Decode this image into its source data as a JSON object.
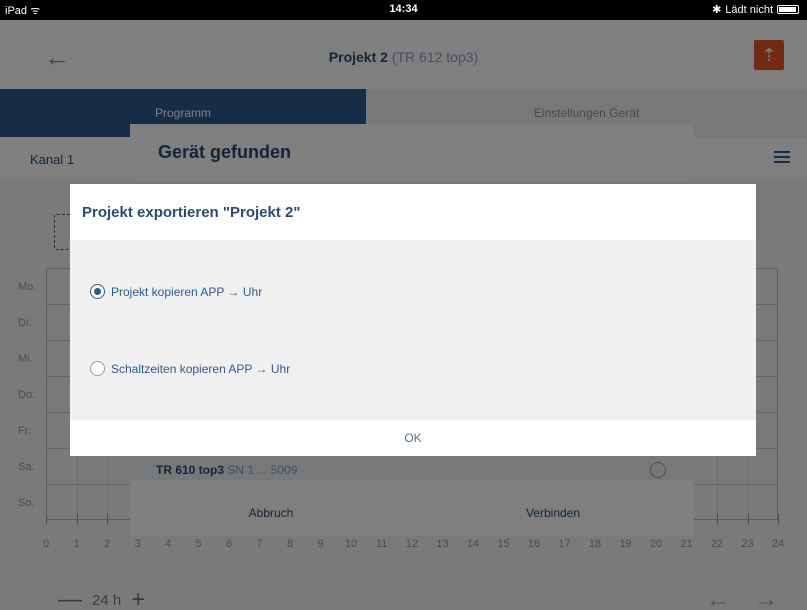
{
  "statusbar": {
    "device": "iPad",
    "time": "14:34",
    "battery_text": "Lädt nicht"
  },
  "header": {
    "title": "Projekt 2",
    "subtitle": "(TR 612 top3)"
  },
  "tabs": [
    {
      "label": "Programm"
    },
    {
      "label": "Einstellungen Gerät"
    }
  ],
  "channel": {
    "label": "Kanal 1"
  },
  "days": [
    "Mo.",
    "Di.",
    "Mi.",
    "Do.",
    "Fr.",
    "Sa.",
    "So."
  ],
  "hours": [
    "0",
    "1",
    "2",
    "3",
    "4",
    "5",
    "6",
    "7",
    "8",
    "9",
    "10",
    "11",
    "12",
    "13",
    "14",
    "15",
    "16",
    "17",
    "18",
    "19",
    "20",
    "21",
    "22",
    "23",
    "24"
  ],
  "zoom": {
    "label": "24 h"
  },
  "found_dialog": {
    "title": "Gerät gefunden",
    "device_name": "TR 610 top3",
    "device_serial": "SN 1 ... 5009",
    "cancel_label": "Abbruch",
    "connect_label": "Verbinden"
  },
  "export_dialog": {
    "title": "Projekt exportieren \"Projekt 2\"",
    "options": [
      {
        "label": "Projekt kopieren APP → Uhr",
        "selected": true
      },
      {
        "label": "Schaltzeiten kopieren APP → Uhr",
        "selected": false
      }
    ],
    "ok_label": "OK"
  },
  "colors": {
    "primary": "#2d5b8f",
    "accent": "#e8562a"
  }
}
